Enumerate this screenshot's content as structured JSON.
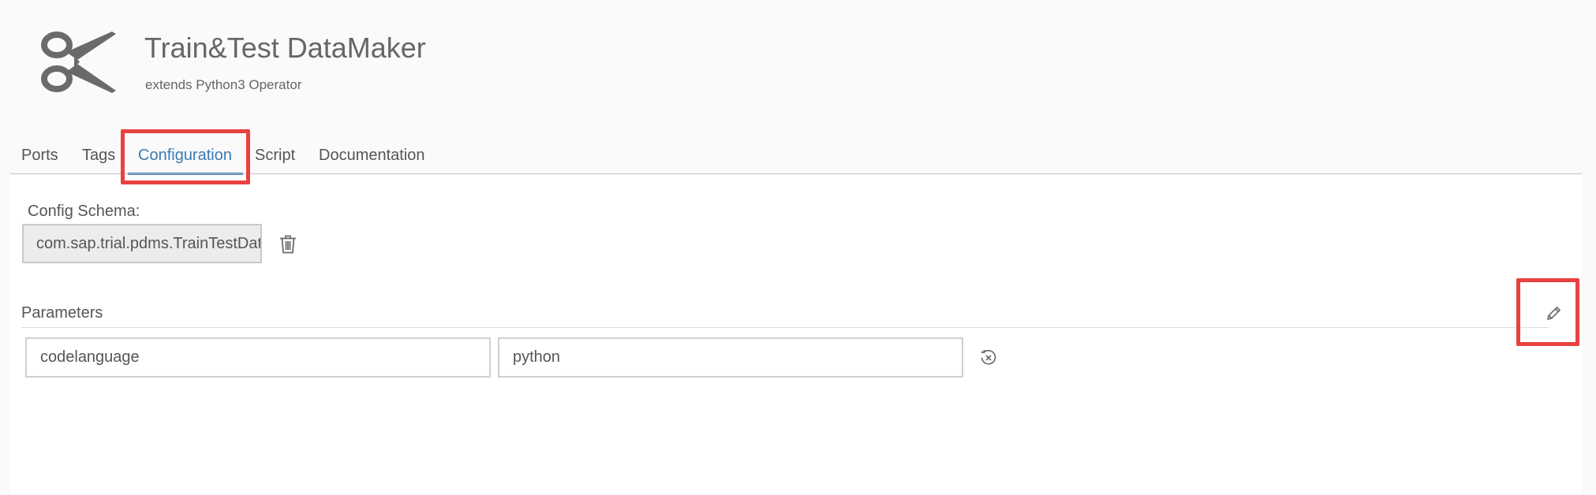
{
  "header": {
    "icon": "scissors-icon",
    "title": "Train&Test DataMaker",
    "subtitle": "extends Python3 Operator"
  },
  "tabs": [
    {
      "label": "Ports",
      "active": false
    },
    {
      "label": "Tags",
      "active": false
    },
    {
      "label": "Configuration",
      "active": true
    },
    {
      "label": "Script",
      "active": false
    },
    {
      "label": "Documentation",
      "active": false
    }
  ],
  "config": {
    "schema_label": "Config Schema:",
    "schema_value": "com.sap.trial.pdms.TrainTestDataMaker",
    "delete_icon": "trash-icon"
  },
  "parameters": {
    "label": "Parameters",
    "edit_icon": "pencil-icon",
    "rows": [
      {
        "name": "codelanguage",
        "value": "python",
        "reset_icon": "reset-icon"
      }
    ]
  },
  "colors": {
    "accent": "#3b79b3",
    "highlight": "#e8413f"
  }
}
